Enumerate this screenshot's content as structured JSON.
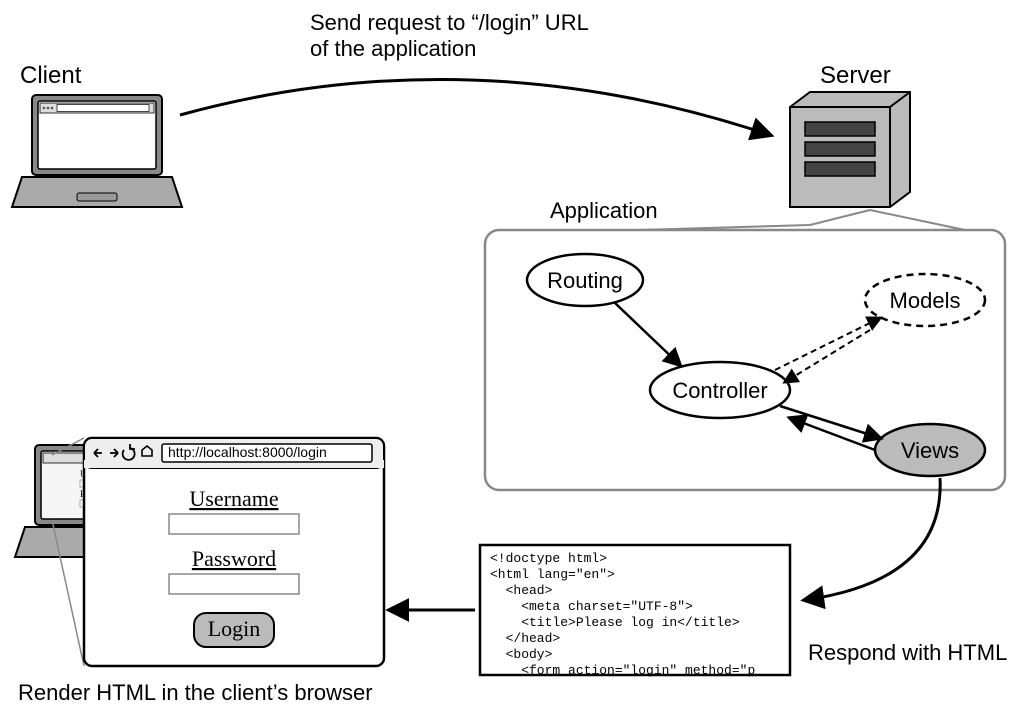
{
  "labels": {
    "client": "Client",
    "server": "Server",
    "application": "Application",
    "send_request_l1": "Send request to “/login” URL",
    "send_request_l2": "of the application",
    "respond_html": "Respond with HTML",
    "render_html": "Render HTML in the client’s browser"
  },
  "app": {
    "routing": "Routing",
    "controller": "Controller",
    "models": "Models",
    "views": "Views"
  },
  "browser": {
    "url_small": "http://localhost:8000/login",
    "url": "http://localhost:8000/login",
    "username": "Username",
    "password": "Password",
    "login": "Login",
    "us_short": "Us",
    "pa_short": "Pa"
  },
  "code": {
    "l1": "<!doctype html>",
    "l2": "<html lang=\"en\">",
    "l3": "  <head>",
    "l4": "    <meta charset=\"UTF-8\">",
    "l5": "    <title>Please log in</title>",
    "l6": "  </head>",
    "l7": "  <body>",
    "l8": "    <form action=\"login\" method=\"p"
  }
}
